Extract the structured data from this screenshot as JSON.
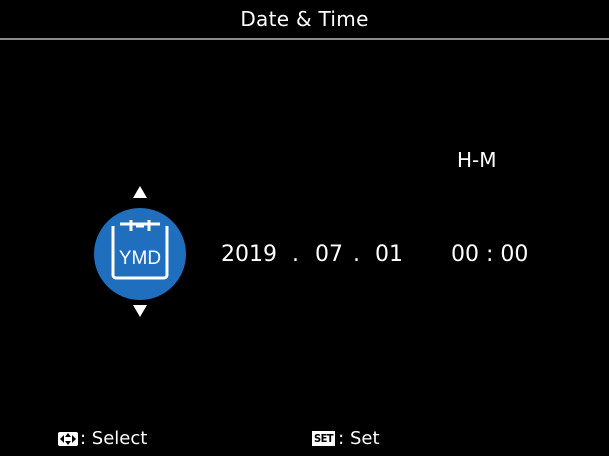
{
  "header": {
    "title": "Date & Time"
  },
  "time_format_label": "H-M",
  "date_format_icon": {
    "name": "ymd-calendar-icon",
    "text": "YMD",
    "color": "#1f6fbe"
  },
  "date": {
    "year": "2019",
    "sep1": ".",
    "month": "07",
    "sep2": ".",
    "day": "01"
  },
  "time": {
    "value": "00 : 00"
  },
  "footer": {
    "select_icon": "dpad-icon",
    "select_label": ": Select",
    "set_icon_text": "SET",
    "set_label": ": Set"
  }
}
